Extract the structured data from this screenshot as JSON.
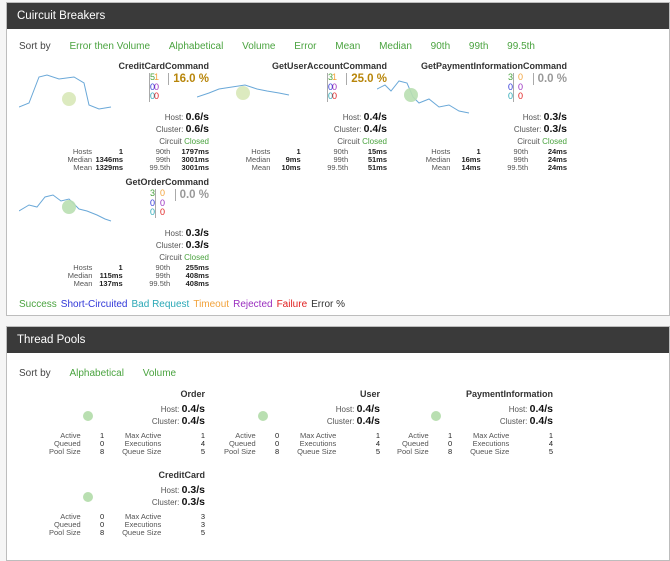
{
  "circuit": {
    "title": "Cuircuit Breakers",
    "sort_label": "Sort by",
    "sort_options": [
      "Error then Volume",
      "Alphabetical",
      "Volume",
      "Error",
      "Mean",
      "Median",
      "90th",
      "99th",
      "99.5th"
    ],
    "host_label": "Host:",
    "cluster_label": "Cluster:",
    "circuit_label": "Circuit",
    "stat_labels": {
      "hosts": "Hosts",
      "median": "Median",
      "mean": "Mean",
      "p90": "90th",
      "p99": "99th",
      "p995": "99.5th"
    },
    "commands": [
      {
        "name": "CreditCardCommand",
        "success": "5",
        "short": "0",
        "bad": "0",
        "timeout": "1",
        "rejected": "0",
        "failure": "0",
        "error_pct": "16.0 %",
        "pct_color": "#b8860b",
        "host_rate": "0.6/s",
        "cluster_rate": "0.6/s",
        "circuit_status": "Closed",
        "hosts": "1",
        "median": "1346ms",
        "mean": "1329ms",
        "p90": "1797ms",
        "p99": "3001ms",
        "p995": "3001ms"
      },
      {
        "name": "GetUserAccountCommand",
        "success": "3",
        "short": "0",
        "bad": "0",
        "timeout": "1",
        "rejected": "0",
        "failure": "0",
        "error_pct": "25.0 %",
        "pct_color": "#b8860b",
        "host_rate": "0.4/s",
        "cluster_rate": "0.4/s",
        "circuit_status": "Closed",
        "hosts": "1",
        "median": "9ms",
        "mean": "10ms",
        "p90": "15ms",
        "p99": "51ms",
        "p995": "51ms"
      },
      {
        "name": "GetPaymentInformationCommand",
        "success": "3",
        "short": "0",
        "bad": "0",
        "timeout": "0",
        "rejected": "0",
        "failure": "0",
        "error_pct": "0.0 %",
        "pct_color": "#999999",
        "host_rate": "0.3/s",
        "cluster_rate": "0.3/s",
        "circuit_status": "Closed",
        "hosts": "1",
        "median": "16ms",
        "mean": "14ms",
        "p90": "24ms",
        "p99": "24ms",
        "p995": "24ms"
      },
      {
        "name": "GetOrderCommand",
        "success": "3",
        "short": "0",
        "bad": "0",
        "timeout": "0",
        "rejected": "0",
        "failure": "0",
        "error_pct": "0.0 %",
        "pct_color": "#999999",
        "host_rate": "0.3/s",
        "cluster_rate": "0.3/s",
        "circuit_status": "Closed",
        "hosts": "1",
        "median": "115ms",
        "mean": "137ms",
        "p90": "255ms",
        "p99": "408ms",
        "p995": "408ms"
      }
    ],
    "legend": {
      "success": "Success",
      "short": "Short-Circuited",
      "bad": "Bad Request",
      "timeout": "Timeout",
      "rejected": "Rejected",
      "failure": "Failure",
      "error": "Error %"
    }
  },
  "thread": {
    "title": "Thread Pools",
    "sort_label": "Sort by",
    "sort_options": [
      "Alphabetical",
      "Volume"
    ],
    "host_label": "Host:",
    "cluster_label": "Cluster:",
    "stat_labels": {
      "active": "Active",
      "queued": "Queued",
      "pool_size": "Pool Size",
      "max_active": "Max Active",
      "executions": "Executions",
      "queue_size": "Queue Size"
    },
    "pools": [
      {
        "name": "Order",
        "host_rate": "0.4/s",
        "cluster_rate": "0.4/s",
        "active": "1",
        "queued": "0",
        "pool_size": "8",
        "max_active": "1",
        "executions": "4",
        "queue_size": "5"
      },
      {
        "name": "User",
        "host_rate": "0.4/s",
        "cluster_rate": "0.4/s",
        "active": "0",
        "queued": "0",
        "pool_size": "8",
        "max_active": "1",
        "executions": "4",
        "queue_size": "5"
      },
      {
        "name": "PaymentInformation",
        "host_rate": "0.4/s",
        "cluster_rate": "0.4/s",
        "active": "1",
        "queued": "0",
        "pool_size": "8",
        "max_active": "1",
        "executions": "4",
        "queue_size": "5"
      },
      {
        "name": "CreditCard",
        "host_rate": "0.3/s",
        "cluster_rate": "0.3/s",
        "active": "0",
        "queued": "0",
        "pool_size": "8",
        "max_active": "3",
        "executions": "3",
        "queue_size": "5"
      }
    ]
  },
  "colors": {
    "success": "#4aa33f",
    "short": "#2f36d8",
    "bad": "#2aa8b6",
    "timeout": "#f2a23a",
    "rejected": "#9a2fbf",
    "failure": "#e02020",
    "header_bg": "#3a3a3a"
  }
}
